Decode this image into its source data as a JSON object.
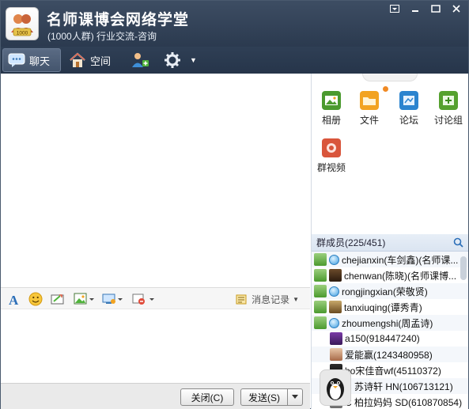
{
  "window": {
    "title": "名师课博会网络学堂",
    "subtitle": "(1000人群) 行业交流-咨询",
    "avatar_badge": "1000",
    "accent": "#2f3f55"
  },
  "tabs": [
    {
      "label": "聊天",
      "icon": "chat-bubble-icon"
    },
    {
      "label": "空间",
      "icon": "house-icon"
    },
    {
      "label": "",
      "icon": "add-member-icon"
    },
    {
      "label": "",
      "icon": "gear-icon"
    }
  ],
  "apps": [
    {
      "label": "相册",
      "icon": "photo-album-icon",
      "color": "#4b9a2f"
    },
    {
      "label": "文件",
      "icon": "folder-icon",
      "color": "#f2a321"
    },
    {
      "label": "论坛",
      "icon": "forum-icon",
      "color": "#2c84cf"
    },
    {
      "label": "讨论组",
      "icon": "discussion-icon",
      "color": "#55a12e"
    },
    {
      "label": "群视频",
      "icon": "video-icon",
      "color": "#d9553b"
    }
  ],
  "input_toolbar": {
    "message_record_label": "消息记录"
  },
  "buttons": {
    "close": "关闭(C)",
    "send": "发送(S)"
  },
  "members": {
    "header": "群成员(225/451)",
    "list": [
      "chejianxin(车剑鑫)(名师课...",
      "chenwan(陈晓)(名师课博...",
      "rongjingxian(荣敬贤)",
      "tanxiuqing(谭秀青)",
      "zhoumengshi(周孟诗)",
      "a150(918447240)",
      "爱能赢(1243480958)",
      "bo宋佳音wf(45110372)",
      "C 苏诗轩 HN(106713121)",
      "C 柏拉妈妈 SD(610870854)"
    ]
  }
}
